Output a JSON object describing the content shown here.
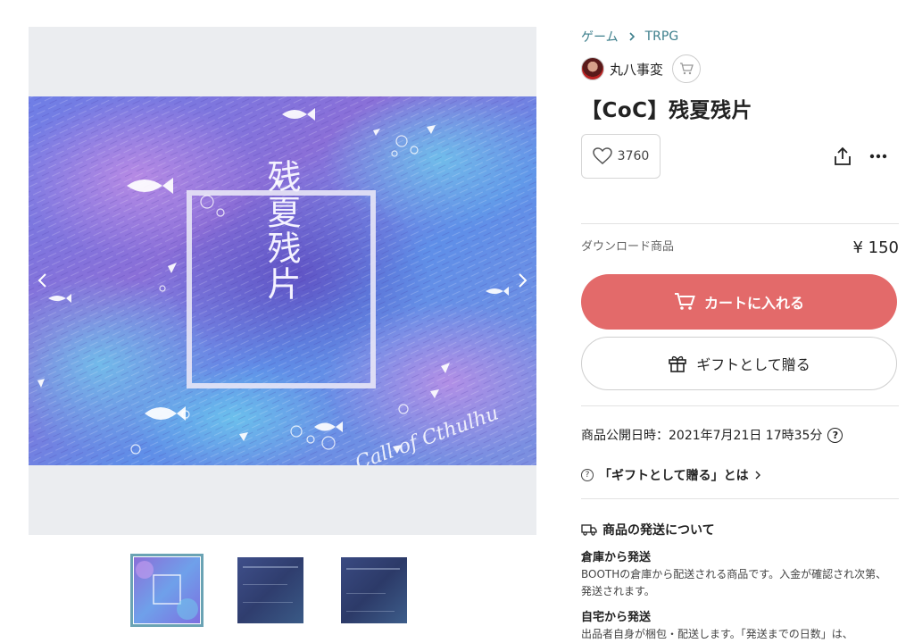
{
  "breadcrumb": {
    "category": "ゲーム",
    "subcategory": "TRPG"
  },
  "shop": {
    "name": "丸八事変"
  },
  "product": {
    "title": "【CoC】残夏残片",
    "likes": "3760",
    "type": "ダウンロード商品",
    "price": "¥ 150",
    "published": "商品公開日時：2021年7月21日 17時35分"
  },
  "buttons": {
    "cart": "カートに入れる",
    "gift": "ギフトとして贈る"
  },
  "gift_about": "「ギフトとして贈る」とは",
  "shipping": {
    "heading": "商品の発送について",
    "warehouse_title": "倉庫から発送",
    "warehouse_text_1": "BOOTHの倉庫から配送される商品です。入金が確認され次第、",
    "warehouse_text_2": "発送されます。",
    "home_title": "自宅から発送",
    "home_text_1": "出品者自身が梱包・配送します。「発送までの日数」は、"
  },
  "art": {
    "title_vertical": "残夏残片",
    "signature": "Call of Cthulhu"
  },
  "colors": {
    "link": "#3d7f8c",
    "cart_button": "#e36a6a",
    "thumb_active_border": "#6aa3b4",
    "gallery_bg": "#ebedf0"
  },
  "icons": [
    "chevron-right-icon",
    "cart-icon",
    "heart-icon",
    "share-icon",
    "more-icon",
    "gift-icon",
    "help-icon",
    "truck-icon",
    "arrow-left-icon",
    "arrow-right-icon"
  ]
}
